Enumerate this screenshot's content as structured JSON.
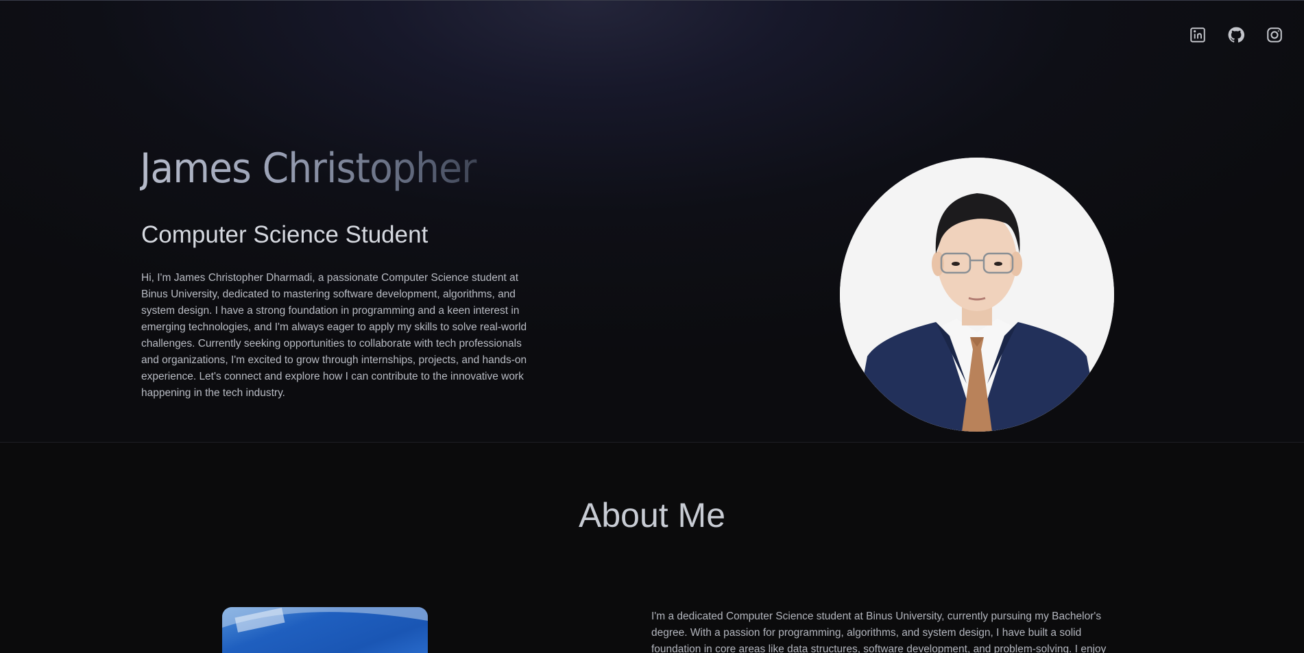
{
  "hero": {
    "name": "James Christopher",
    "subtitle": "Computer Science Student",
    "bio": "Hi, I'm James Christopher Dharmadi, a passionate Computer Science student at Binus University, dedicated to mastering software development, algorithms, and system design. I have a strong foundation in programming and a keen interest in emerging technologies, and I'm always eager to apply my skills to solve real-world challenges. Currently seeking opportunities to collaborate with tech professionals and organizations, I'm excited to grow through internships, projects, and hands-on experience. Let's connect and explore how I can contribute to the innovative work happening in the tech industry."
  },
  "social": [
    {
      "icon": "linkedin-icon"
    },
    {
      "icon": "github-icon"
    },
    {
      "icon": "instagram-icon"
    }
  ],
  "about": {
    "title": "About Me",
    "text": "I'm a dedicated Computer Science student at Binus University, currently pursuing my Bachelor's degree. With a passion for programming, algorithms, and system design, I have built a solid foundation in core areas like data structures, software development, and problem-solving. I enjoy exploring how emerging"
  },
  "colors": {
    "background": "#0b0b0c",
    "hero_gradient_top": "#24253a",
    "text": "#b9bcc4"
  }
}
